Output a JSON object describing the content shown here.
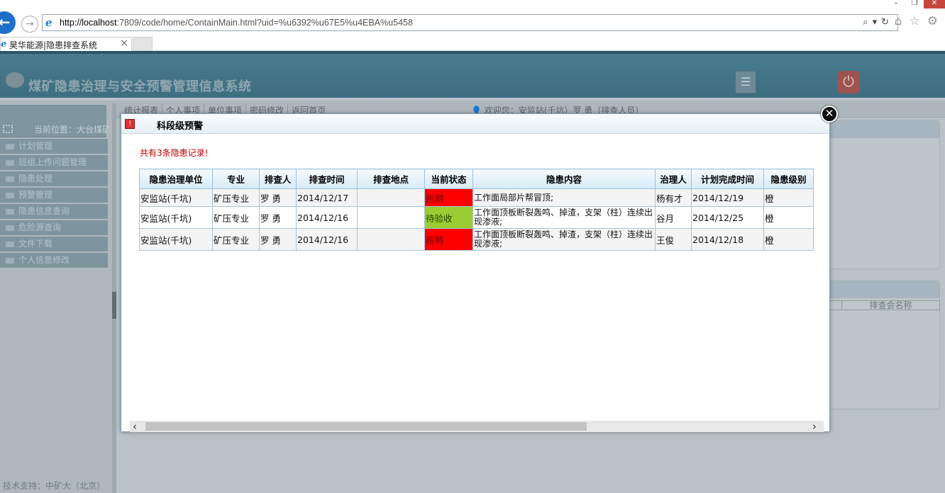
{
  "browser": {
    "window_controls": [
      "–",
      "❐",
      "✕"
    ],
    "url_host": "http://localhost",
    "url_rest": ":7809/code/home/ContainMain.html?uid=%u6392%u67E5%u4EBA%u5458",
    "tab_title": "昊华能源|隐患排查系统"
  },
  "app": {
    "title": "煤矿隐患治理与安全预警管理信息系统",
    "top_menu": [
      "统计报表",
      "个人事项",
      "单位事项",
      "密码修改",
      "返回首页"
    ],
    "welcome": "欢迎您：安监站(千坑）罗 勇（排查人员）",
    "location": "当前位置：大台煤矿",
    "sidebar": [
      "计划管理",
      "班组上传问题管理",
      "隐患处理",
      "预警管理",
      "隐患信息查询",
      "危险源查询",
      "文件下载",
      "个人信息修改"
    ],
    "footer": "技术支持：中矿大（北京）",
    "right_column_header": "排查会名称"
  },
  "modal": {
    "title": "科段级预警",
    "record_count": "共有3条隐患记录!",
    "columns": [
      "隐患治理单位",
      "专业",
      "排查人",
      "排查时间",
      "排查地点",
      "当前状态",
      "隐患内容",
      "治理人",
      "计划完成时间",
      "隐患级别"
    ],
    "rows": [
      {
        "unit": "安监站(千坑)",
        "specialty": "矿压专业",
        "inspector": "罗 勇",
        "time": "2014/12/17",
        "location": "",
        "status": "超期",
        "content": "工作面局部片帮冒顶;",
        "handler": "杨有才",
        "due": "2014/12/19",
        "level": "橙"
      },
      {
        "unit": "安监站(千坑)",
        "specialty": "矿压专业",
        "inspector": "罗 勇",
        "time": "2014/12/16",
        "location": "",
        "status": "待验收",
        "content": "工作面顶板断裂轰鸣、掉渣，支架（柱）连续出现渗液;",
        "handler": "谷月",
        "due": "2014/12/25",
        "level": "橙"
      },
      {
        "unit": "安监站(千坑)",
        "specialty": "矿压专业",
        "inspector": "罗 勇",
        "time": "2014/12/16",
        "location": "",
        "status": "超期",
        "content": "工作面顶板断裂轰鸣、掉渣，支架（柱）连续出现渗液;",
        "handler": "王俊",
        "due": "2014/12/18",
        "level": "橙"
      }
    ],
    "close_symbol": "✕",
    "status_colors": {
      "超期": "#ff0000",
      "待验收": "#9acd32"
    }
  }
}
